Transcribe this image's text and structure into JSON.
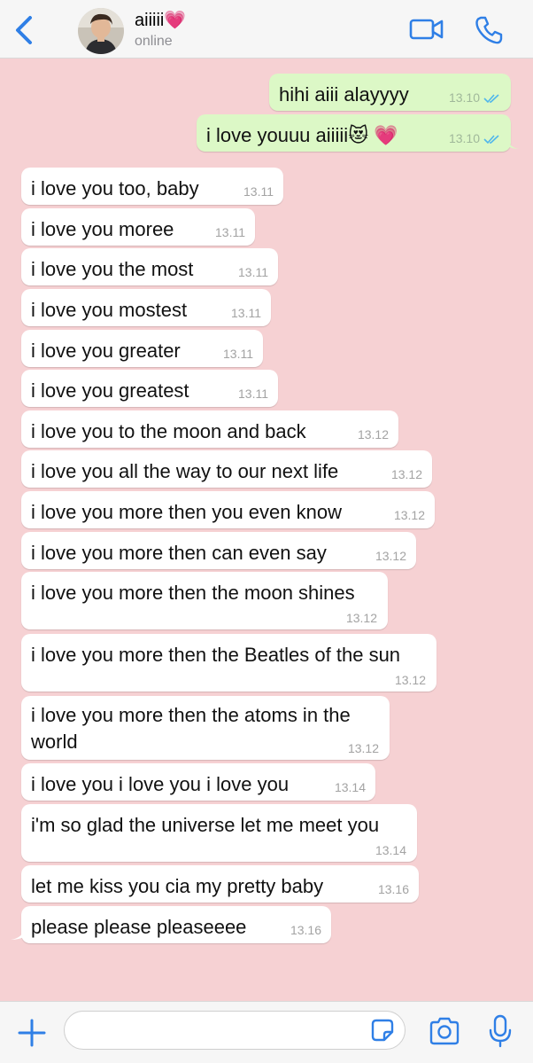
{
  "header": {
    "contact_name": "aiiiii💗",
    "status": "online"
  },
  "messages": [
    {
      "dir": "out",
      "text": "hihi aiii alayyyy",
      "time": "13.10",
      "read": true
    },
    {
      "dir": "out",
      "text": "i love youuu aiiiii😻 💗",
      "time": "13.10",
      "read": true
    },
    {
      "dir": "in",
      "text": "i love you too, baby",
      "time": "13.11"
    },
    {
      "dir": "in",
      "text": "i love you moree",
      "time": "13.11"
    },
    {
      "dir": "in",
      "text": "i love you the most",
      "time": "13.11"
    },
    {
      "dir": "in",
      "text": "i love you mostest",
      "time": "13.11"
    },
    {
      "dir": "in",
      "text": "i love you greater",
      "time": "13.11"
    },
    {
      "dir": "in",
      "text": "i love you greatest",
      "time": "13.11"
    },
    {
      "dir": "in",
      "text": "i love you to the moon and back",
      "time": "13.12"
    },
    {
      "dir": "in",
      "text": "i love you all the way to our next life",
      "time": "13.12"
    },
    {
      "dir": "in",
      "text": "i love you more then you even know",
      "time": "13.12"
    },
    {
      "dir": "in",
      "text": "i love you more then can even say",
      "time": "13.12"
    },
    {
      "dir": "in",
      "text": "i love you more then the moon shines",
      "time": "13.12"
    },
    {
      "dir": "in",
      "text": "i love you more then the Beatles of the sun",
      "time": "13.12"
    },
    {
      "dir": "in",
      "text": "i love you more then the atoms in the world",
      "time": "13.12"
    },
    {
      "dir": "in",
      "text": "i love you i love you i love you",
      "time": "13.14"
    },
    {
      "dir": "in",
      "text": "i'm so glad the universe let me meet you",
      "time": "13.14"
    },
    {
      "dir": "in",
      "text": "let me kiss you cia my pretty baby",
      "time": "13.16"
    },
    {
      "dir": "in",
      "text": "please please pleaseeee",
      "time": "13.16"
    }
  ],
  "composer": {
    "value": "",
    "placeholder": ""
  },
  "colors": {
    "chat_background": "#f6d1d3",
    "outgoing_bubble": "#dcf8c6",
    "incoming_bubble": "#ffffff",
    "accent": "#2f7fe6",
    "read_tick": "#4fb6ec"
  },
  "icons": {
    "back": "chevron-left-icon",
    "video": "video-camera-icon",
    "call": "phone-icon",
    "attach": "plus-icon",
    "sticker": "sticker-icon",
    "camera": "camera-icon",
    "mic": "microphone-icon"
  }
}
